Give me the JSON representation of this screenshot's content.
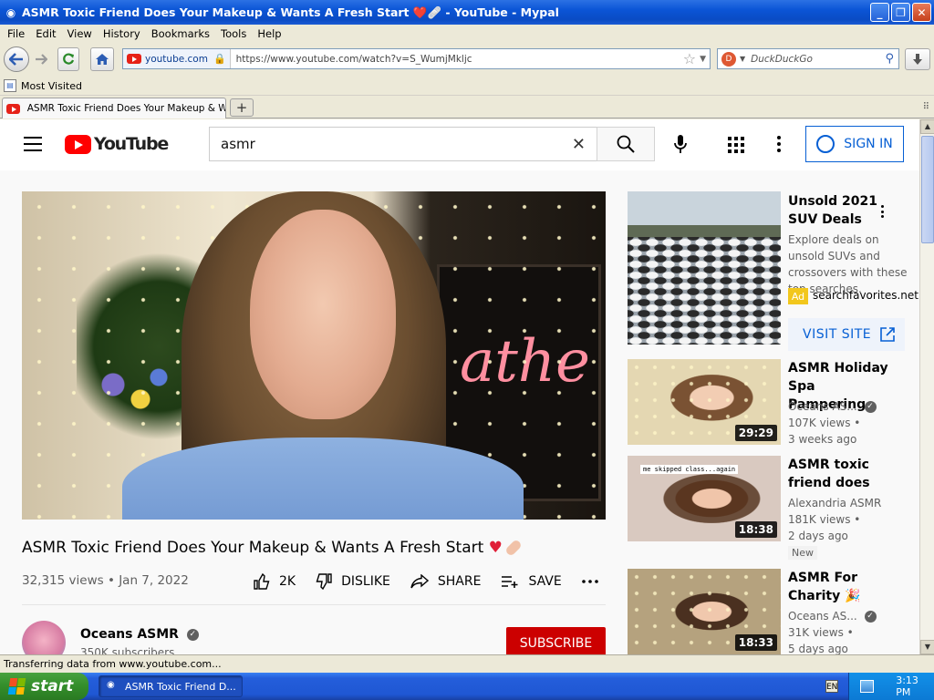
{
  "window": {
    "title": "ASMR Toxic Friend Does Your Makeup & Wants A Fresh Start ❤️🩹 - YouTube - Mypal",
    "buttons": {
      "minimize": "_",
      "maximize": "❐",
      "close": "✕"
    }
  },
  "menu": [
    "File",
    "Edit",
    "View",
    "History",
    "Bookmarks",
    "Tools",
    "Help"
  ],
  "nav": {
    "site_chip": "youtube.com",
    "url": "https://www.youtube.com/watch?v=S_WumjMkljc",
    "search_engine_placeholder": "DuckDuckGo"
  },
  "bookmarks": {
    "most_visited": "Most Visited"
  },
  "tabs": [
    {
      "label": "ASMR Toxic Friend Does Your Makeup & Wa..."
    }
  ],
  "youtube": {
    "logo_text": "YouTube",
    "search_query": "asmr",
    "signin_label": "SIGN IN",
    "video": {
      "title": "ASMR Toxic Friend Does Your Makeup & Wants A Fresh Start",
      "title_emoji": "♥",
      "meta": "32,315 views • Jan 7, 2022",
      "neon_text": "athe",
      "actions": {
        "likes": "2K",
        "dislike": "DISLIKE",
        "share": "SHARE",
        "save": "SAVE"
      }
    },
    "channel": {
      "name": "Oceans ASMR",
      "subscribers": "350K subscribers",
      "subscribe_label": "SUBSCRIBE"
    },
    "ad": {
      "title": "Unsold 2021 SUV Deals",
      "description": "Explore deals on unsold SUVs and crossovers with these top searches.",
      "badge": "Ad",
      "domain": "searchfavorites.net",
      "cta": "VISIT SITE"
    },
    "recommendations": [
      {
        "title": "ASMR Holiday Spa Pampering",
        "channel": "Oceans AS...",
        "views": "107K views •",
        "age": "3 weeks ago",
        "duration": "29:29",
        "verified": true
      },
      {
        "title": "ASMR toxic friend does",
        "channel": "Alexandria ASMR",
        "views": "181K views •",
        "age": "2 days ago",
        "duration": "18:38",
        "badge": "New",
        "caption": "me skipped class...again"
      },
      {
        "title": "ASMR For Charity",
        "title_emoji": "🎉",
        "channel": "Oceans AS...",
        "views": "31K views •",
        "age": "5 days ago",
        "duration": "18:33",
        "verified": true
      }
    ]
  },
  "status": "Transferring data from www.youtube.com...",
  "taskbar": {
    "start": "start",
    "task": "ASMR Toxic Friend D...",
    "lang": "EN",
    "clock": "3:13 PM"
  }
}
